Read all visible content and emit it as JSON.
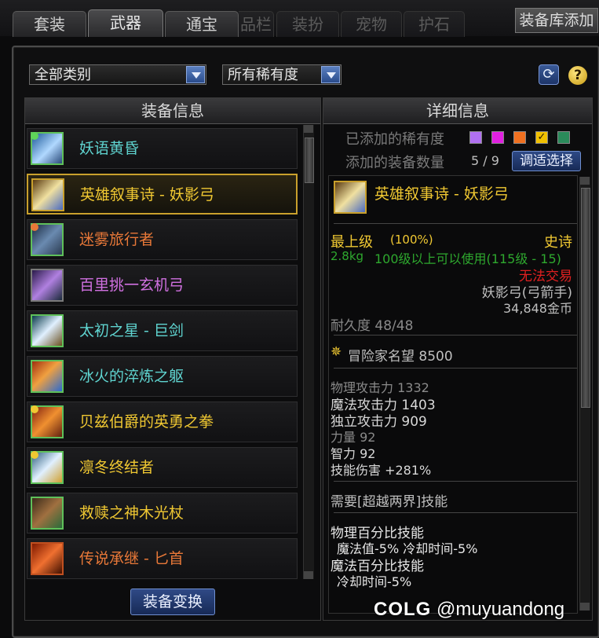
{
  "tabs": [
    {
      "label": "套装"
    },
    {
      "label": "武器"
    },
    {
      "label": "通宝"
    },
    {
      "label": "品栏"
    },
    {
      "label": "装扮"
    },
    {
      "label": "宠物"
    },
    {
      "label": "护石"
    }
  ],
  "add_library_button": "装备库添加",
  "filters": {
    "category": "全部类别",
    "rarity": "所有稀有度"
  },
  "equip_panel": {
    "title": "装备信息",
    "items": [
      {
        "name": "妖语黄昏",
        "color": "#5fd4d0"
      },
      {
        "name": "英雄叙事诗 - 妖影弓",
        "color": "#f0c832"
      },
      {
        "name": "迷雾旅行者",
        "color": "#e87838"
      },
      {
        "name": "百里挑一玄机弓",
        "color": "#d070e0"
      },
      {
        "name": "太初之星 - 巨剑",
        "color": "#5fd4d0"
      },
      {
        "name": "冰火的淬炼之躯",
        "color": "#5fd4d0"
      },
      {
        "name": "贝兹伯爵的英勇之拳",
        "color": "#f0c832"
      },
      {
        "name": "凛冬终结者",
        "color": "#f0c832"
      },
      {
        "name": "救赎之神木光杖",
        "color": "#f0c832"
      },
      {
        "name": "传说承继 - 匕首",
        "color": "#e87838"
      }
    ],
    "convert_button": "装备变换"
  },
  "detail_panel": {
    "title": "详细信息",
    "added_rarity_label": "已添加的稀有度",
    "rarity_colors": [
      "#b070f0",
      "#e020e0",
      "#f07020",
      "#f0c000",
      "#2a8a5a"
    ],
    "added_count_label": "添加的装备数量",
    "added_count": "5 / 9",
    "adjust_button": "调适选择",
    "item_name": "英雄叙事诗 - 妖影弓",
    "grade": "最上级",
    "grade_pct": "(100%)",
    "rarity": "史诗",
    "weight": "2.8kg",
    "level_req": "100级以上可以使用(115级 - 15)",
    "trade": "无法交易",
    "type": "妖影弓(弓箭手)",
    "price": "34,848金币",
    "durability": "耐久度 48/48",
    "reputation": "冒险家名望 8500",
    "stats": [
      "物理攻击力 1332",
      "魔法攻击力 1403",
      "独立攻击力 909",
      "力量 92",
      "智力 92",
      "技能伤害 +281%"
    ],
    "requirement": "需要[超越两界]技能",
    "skills": [
      "物理百分比技能",
      "魔法值-5% 冷却时间-5%",
      "魔法百分比技能",
      "冷却时间-5%"
    ]
  },
  "watermark": {
    "logo": "COLG",
    "handle": "@muyuandong"
  }
}
